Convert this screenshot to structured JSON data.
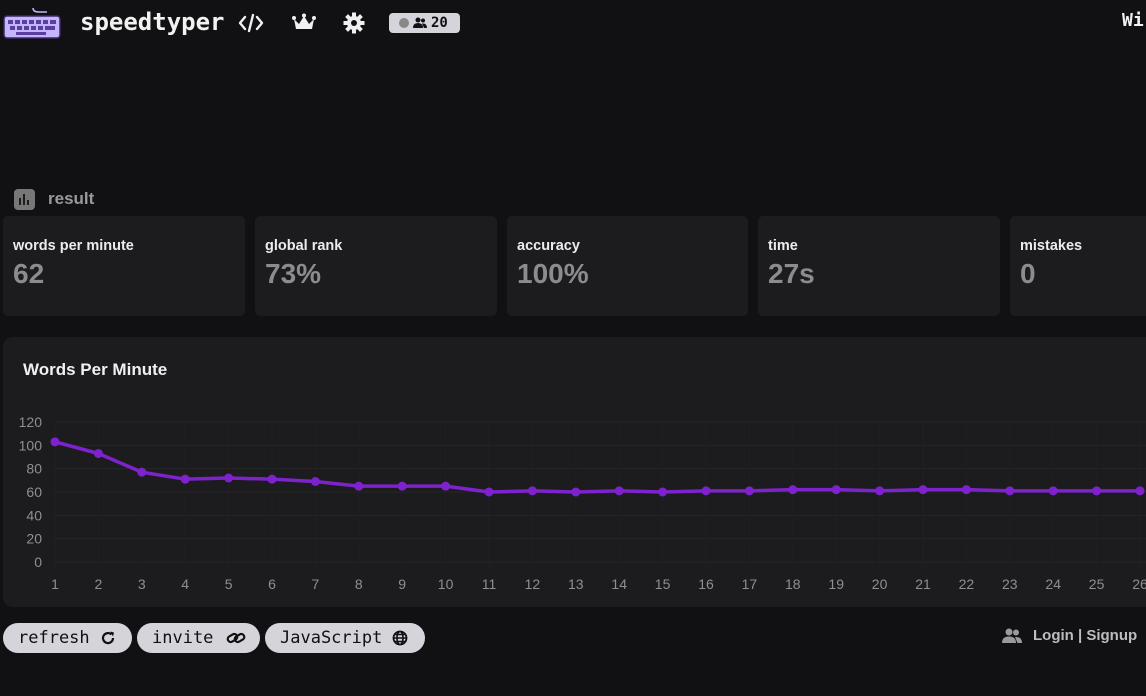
{
  "app": {
    "name": "speedtyper",
    "top_right_cut": "Wi",
    "online_count": "20"
  },
  "nav": {
    "icons": [
      "code-icon",
      "crown-icon",
      "gear-icon"
    ]
  },
  "result": {
    "label": "result",
    "stats": [
      {
        "title": "words per minute",
        "value": "62"
      },
      {
        "title": "global rank",
        "value": "73%"
      },
      {
        "title": "accuracy",
        "value": "100%"
      },
      {
        "title": "time",
        "value": "27s"
      },
      {
        "title": "mistakes",
        "value": "0"
      }
    ]
  },
  "chart_data": {
    "type": "line",
    "title": "Words Per Minute",
    "x": [
      1,
      2,
      3,
      4,
      5,
      6,
      7,
      8,
      9,
      10,
      11,
      12,
      13,
      14,
      15,
      16,
      17,
      18,
      19,
      20,
      21,
      22,
      23,
      24,
      25,
      26
    ],
    "series": [
      {
        "values": [
          103,
          93,
          77,
          71,
          72,
          71,
          69,
          65,
          65,
          65,
          60,
          61,
          60,
          61,
          60,
          61,
          61,
          62,
          62,
          61,
          62,
          62,
          61,
          61,
          61,
          61
        ]
      }
    ],
    "ylim": [
      0,
      120
    ],
    "yticks": [
      0,
      20,
      40,
      60,
      80,
      100,
      120
    ],
    "grid": true,
    "color": "#7e22ce"
  },
  "actions": {
    "refresh": "refresh",
    "invite": "invite",
    "language": "JavaScript",
    "login": "Login | Signup"
  },
  "colors": {
    "background": "#111113",
    "card": "#1c1c1f",
    "pill": "#d4d4da",
    "logo": "#c4b5fd",
    "line": "#7e22ce"
  }
}
